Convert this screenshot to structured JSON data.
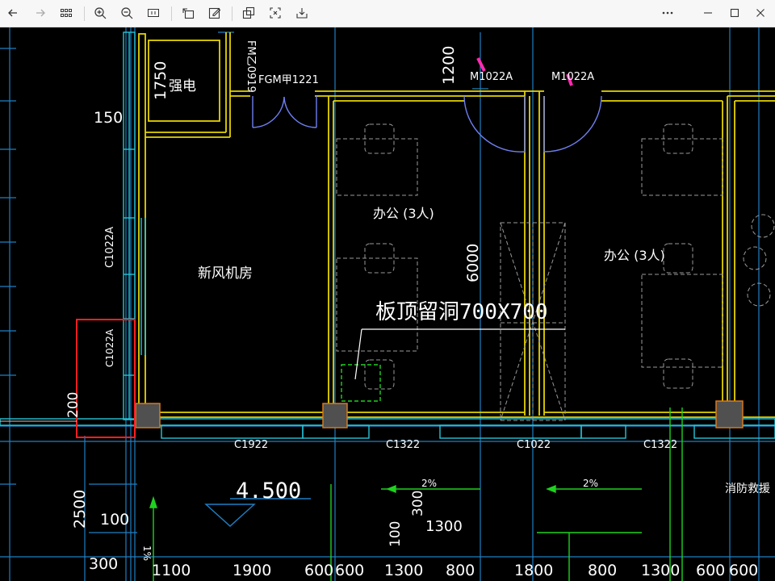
{
  "toolbar": {
    "back": "back-icon",
    "forward": "forward-icon",
    "grid": "grid-icon",
    "zoom_in": "zoom-in-icon",
    "zoom_out": "zoom-out-icon",
    "fit": "fit-icon",
    "rotate": "rotate-icon",
    "edit": "edit-icon",
    "copy": "copy-icon",
    "fullscreen": "fullscreen-icon",
    "download": "download-icon",
    "more": "more-icon",
    "minimize": "minimize-icon",
    "maximize": "maximize-icon",
    "close": "close-icon"
  },
  "drawing": {
    "colors": {
      "yellow": "#e5d400",
      "cyan": "#27c4d6",
      "blue": "#1f7fc4",
      "green": "#1fd11f",
      "red": "#ff2020",
      "magenta": "#ff2bb0",
      "white": "#ffffff",
      "gray": "#9a9a9a",
      "orange": "#d9791b"
    },
    "labels": {
      "room_newair": "新风机房",
      "room_office_left": "办公 (3人)",
      "room_office_right": "办公 (3人)",
      "room_elec": "强电",
      "slab_hole": "板顶留洞700X700",
      "elev": "4.500",
      "fire": "消防救援",
      "door_fgm": "FGM甲1221",
      "door_fm": "FM乙0919",
      "door_m1": "M1022A",
      "door_m2": "M1022A",
      "win_c1022a_v1": "C1022A",
      "win_c1022a_v2": "C1022A",
      "win_c1922": "C1922",
      "win_c1322_a": "C1322",
      "win_c1022": "C1022",
      "win_c1322_b": "C1322",
      "slope_1": "2%",
      "slope_2": "2%",
      "slope_3": "1%"
    },
    "dims": {
      "d150": "150",
      "d1750": "1750",
      "d1200": "1200",
      "d6000": "6000",
      "d200": "200",
      "d2500": "2500",
      "d100a": "100",
      "d300": "300",
      "d100b": "100",
      "d300b": "300",
      "d1300a": "1300",
      "bottom": [
        "1100",
        "1900",
        "600",
        "600",
        "1300",
        "800",
        "1800",
        "800",
        "1300",
        "600",
        "600"
      ]
    }
  }
}
